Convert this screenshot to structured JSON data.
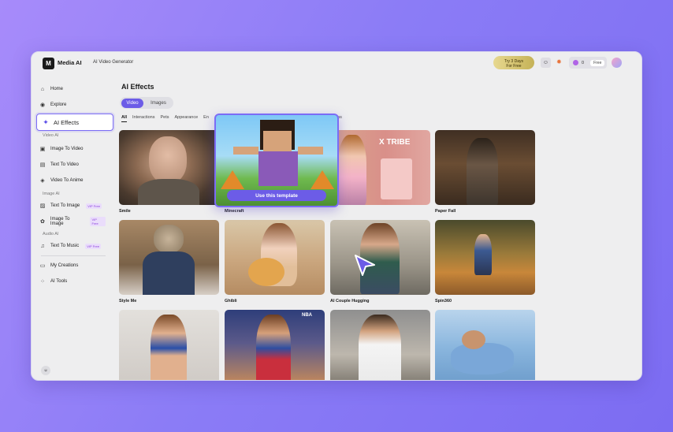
{
  "header": {
    "brand": "Media AI",
    "logo_glyph": "M",
    "app_title": "AI Video Generator",
    "trial_line1": "Try 3 Days",
    "trial_line2": "For Free",
    "credits": "0",
    "free_label": "Free"
  },
  "sidebar": {
    "home": "Home",
    "explore": "Explore",
    "ai_effects": "AI Effects",
    "section_video": "Video AI",
    "image_to_video": "Image To Video",
    "text_to_video": "Text To Video",
    "video_to_anime": "Video To Anime",
    "section_image": "Image AI",
    "text_to_image": "Text To Image",
    "image_to_image": "Image To Image",
    "section_audio": "Audio AI",
    "text_to_music": "Text To Music",
    "vip_label": "VIP Free",
    "my_creations": "My Creations",
    "ai_tools": "AI Tools"
  },
  "main": {
    "title": "AI Effects",
    "seg_video": "Video",
    "seg_images": "Images",
    "categories": [
      "All",
      "Interactions",
      "Pets",
      "Appearance",
      "En"
    ],
    "categories_tail": "ons",
    "use_template": "Use this template",
    "cards": {
      "smile": "Smile",
      "minecraft": "Minecraft",
      "paper_fall": "Paper Fall",
      "style_me": "Style Me",
      "ghibli": "Ghibli",
      "ai_couple_hugging": "AI Couple Hugging",
      "spin360": "Spin360"
    },
    "tribe_text": "X TRIBE",
    "jersey_text": "NBA"
  }
}
